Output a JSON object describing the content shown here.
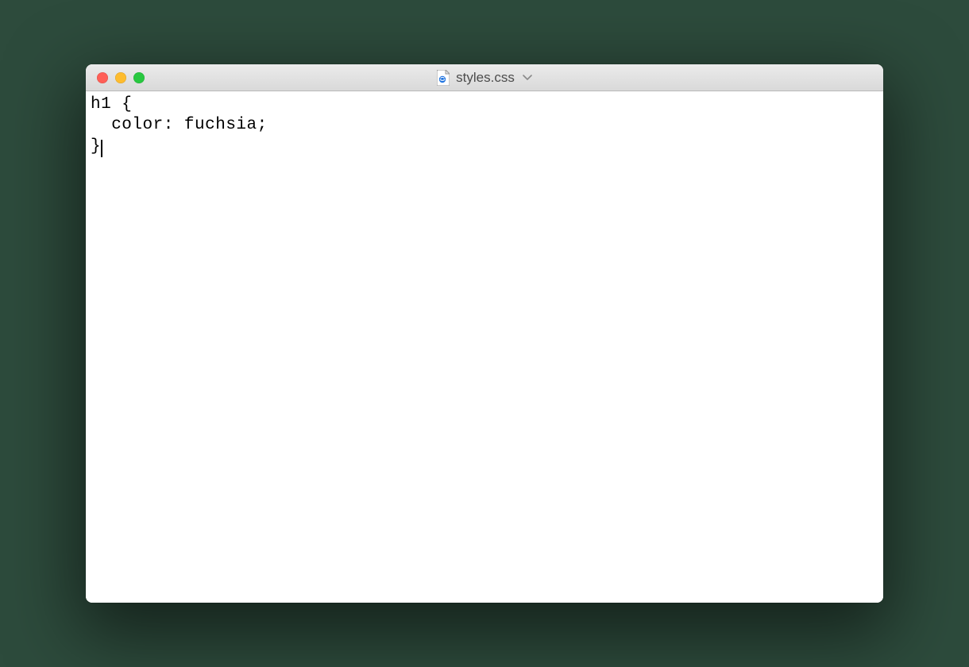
{
  "window": {
    "title": "styles.css",
    "file_icon": "css-file-icon"
  },
  "editor": {
    "lines": [
      "h1 {",
      "  color: fuchsia;",
      "}"
    ],
    "cursor_after_last_line": true
  }
}
